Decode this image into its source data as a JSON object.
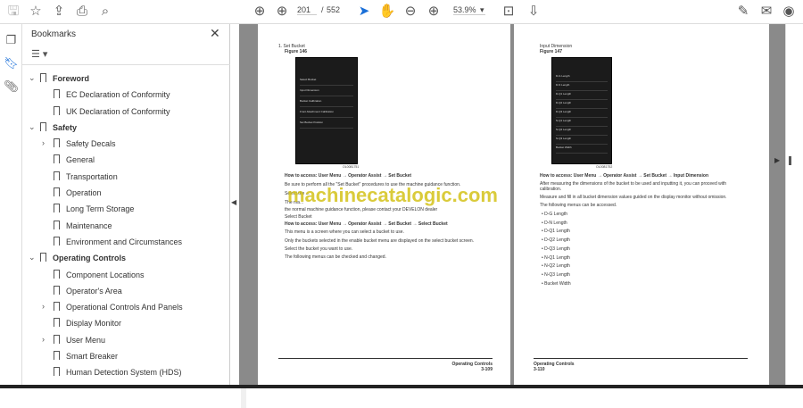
{
  "toolbar": {
    "page_current": "201",
    "page_sep": "/",
    "page_total": "552",
    "zoom": "53.9%"
  },
  "bookmarks": {
    "title": "Bookmarks",
    "items": [
      {
        "label": "Foreword",
        "level": 0,
        "expand": "v"
      },
      {
        "label": "EC Declaration of Conformity",
        "level": 1
      },
      {
        "label": "UK Declaration of Conformity",
        "level": 1
      },
      {
        "label": "Safety",
        "level": 0,
        "expand": "v"
      },
      {
        "label": "Safety Decals",
        "level": 1,
        "expand": ">"
      },
      {
        "label": "General",
        "level": 1
      },
      {
        "label": "Transportation",
        "level": 1
      },
      {
        "label": "Operation",
        "level": 1
      },
      {
        "label": "Long Term Storage",
        "level": 1
      },
      {
        "label": "Maintenance",
        "level": 1
      },
      {
        "label": "Environment and Circumstances",
        "level": 1
      },
      {
        "label": "Operating Controls",
        "level": 0,
        "expand": "v"
      },
      {
        "label": "Component Locations",
        "level": 1
      },
      {
        "label": "Operator's Area",
        "level": 1
      },
      {
        "label": "Operational Controls And Panels",
        "level": 1,
        "expand": ">"
      },
      {
        "label": "Display Monitor",
        "level": 1
      },
      {
        "label": "User Menu",
        "level": 1,
        "expand": ">"
      },
      {
        "label": "Smart Breaker",
        "level": 1
      },
      {
        "label": "Human Detection System (HDS)",
        "level": 1
      }
    ]
  },
  "left_page": {
    "heading": "1.  Set Bucket",
    "figure": "Figure 146",
    "fig_code": "OL0081751",
    "screen_items": [
      "Select Bucket",
      "Input Dimension",
      "Bucket Calibration",
      "Front Attachment Calibration",
      "Set Bucket Position"
    ],
    "lines": [
      "How to access: User Menu → Operator Assist → Set Bucket",
      "Be sure to perform all the \"Set Bucket\" procedures to use the machine guidance function.",
      "Select the ...",
      "The ma...",
      "the normal machine guidance function, please contact your DEVELON dealer",
      "Select Bucket",
      "How to access: User Menu → Operator Assist → Set Bucket → Select Bucket",
      "This menu is a screen where you can select a bucket to use.",
      "Only the buckets selected in the enable bucket menu are displayed on the select bucket screen.",
      "Select the bucket you want to use.",
      "The following menus can be checked and changed."
    ],
    "footer_title": "Operating Controls",
    "footer_page": "3-109"
  },
  "right_page": {
    "heading": "Input Dimension",
    "figure": "Figure 147",
    "fig_code": "OL0081752",
    "lines": [
      "How to access: User Menu → Operator Assist → Set Bucket → Input Dimension",
      "After measuring the dimensions of the bucket to be used and inputting it, you can proceed with",
      "calibration.",
      "Measure and fill in all bucket dimension values guided on the display monitor without omission.",
      "The following menus can be accessed."
    ],
    "bullets": [
      "D-G Length",
      "D-N Length",
      "D-Q1 Length",
      "D-Q2 Length",
      "D-Q3 Length",
      "N-Q1 Length",
      "N-Q2 Length",
      "N-Q3 Length",
      "Bucket Width"
    ],
    "footer_title": "Operating Controls",
    "footer_page": "3-110"
  },
  "watermark": "machinecatalogic.com"
}
